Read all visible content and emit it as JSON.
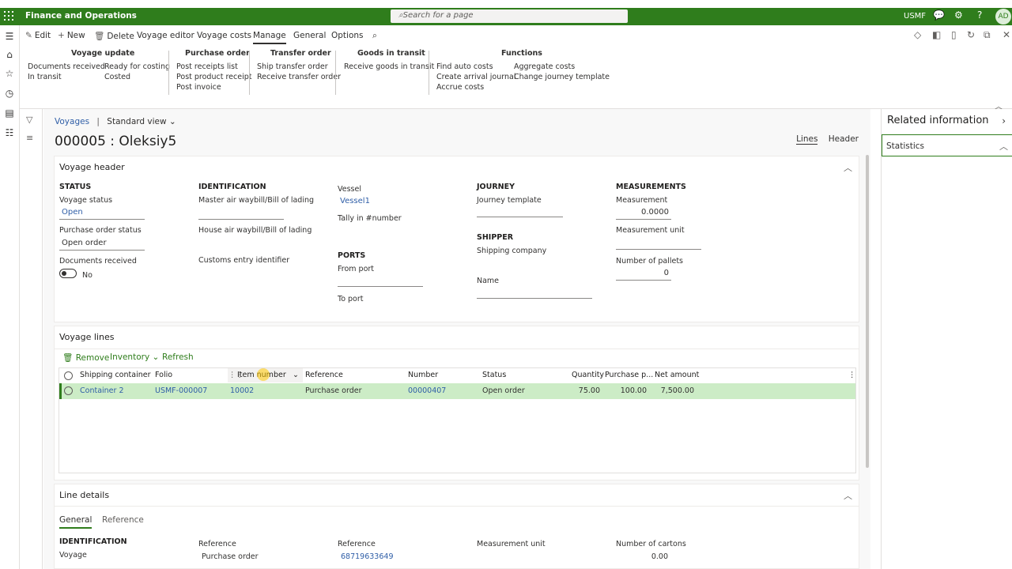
{
  "topbar": {
    "app_title": "Finance and Operations",
    "search_placeholder": "Search for a page",
    "company": "USMF",
    "avatar": "AD"
  },
  "actionbar": {
    "edit": "Edit",
    "new": "New",
    "delete": "Delete",
    "voyage_editor": "Voyage editor",
    "voyage_costs": "Voyage costs",
    "manage": "Manage",
    "general": "General",
    "options": "Options"
  },
  "ribbon": {
    "voyage_update": {
      "title": "Voyage update",
      "items": [
        "Documents received",
        "In transit",
        "Ready for costing",
        "Costed"
      ]
    },
    "purchase_order": {
      "title": "Purchase order",
      "items": [
        "Post receipts list",
        "Post product receipt",
        "Post invoice"
      ]
    },
    "transfer_order": {
      "title": "Transfer order",
      "items": [
        "Ship transfer order",
        "Receive transfer order"
      ]
    },
    "goods_in_transit": {
      "title": "Goods in transit",
      "items": [
        "Receive goods in transit"
      ]
    },
    "functions": {
      "title": "Functions",
      "items": [
        "Find auto costs",
        "Create arrival journal",
        "Accrue costs",
        "Aggregate costs",
        "Change journey template"
      ]
    }
  },
  "page": {
    "breadcrumb_link": "Voyages",
    "separator": "|",
    "view": "Standard view",
    "title": "000005 : Oleksiy5",
    "view_lines": "Lines",
    "view_header": "Header"
  },
  "voyage_header": {
    "title": "Voyage header",
    "status": {
      "section": "STATUS",
      "voyage_status_label": "Voyage status",
      "voyage_status": "Open",
      "po_status_label": "Purchase order status",
      "po_status": "Open order",
      "docs_label": "Documents received",
      "docs_value": "No"
    },
    "identification": {
      "section": "IDENTIFICATION",
      "master_label": "Master air waybill/Bill of lading",
      "house_label": "House air waybill/Bill of lading",
      "customs_label": "Customs entry identifier"
    },
    "vessel": {
      "label": "Vessel",
      "value": "Vessel1",
      "tally_label": "Tally in #number"
    },
    "ports": {
      "section": "PORTS",
      "from_label": "From port",
      "to_label": "To port"
    },
    "journey": {
      "section": "JOURNEY",
      "template_label": "Journey template"
    },
    "shipper": {
      "section": "SHIPPER",
      "company_label": "Shipping company",
      "name_label": "Name"
    },
    "measurements": {
      "section": "MEASUREMENTS",
      "measurement_label": "Measurement",
      "measurement": "0.0000",
      "unit_label": "Measurement unit",
      "pallets_label": "Number of pallets",
      "pallets": "0"
    }
  },
  "voyage_lines": {
    "title": "Voyage lines",
    "remove": "Remove",
    "inventory": "Inventory",
    "refresh": "Refresh",
    "columns": [
      "Shipping container",
      "Folio",
      "Item number",
      "Reference",
      "Number",
      "Status",
      "Quantity",
      "Purchase p...",
      "Net amount"
    ],
    "rows": [
      {
        "container": "Container 2",
        "folio": "USMF-000007",
        "item": "10002",
        "reference": "Purchase order",
        "number": "00000407",
        "status": "Open order",
        "quantity": "75.00",
        "price": "100.00",
        "net": "7,500.00"
      }
    ]
  },
  "line_details": {
    "title": "Line details",
    "tab_general": "General",
    "tab_reference": "Reference",
    "identification": "IDENTIFICATION",
    "voyage_label": "Voyage",
    "reference_label": "Reference",
    "reference_value": "Purchase order",
    "reference2_label": "Reference",
    "reference2_value": "68719633649",
    "unit_label": "Measurement unit",
    "cartons_label": "Number of cartons",
    "cartons_value": "0.00"
  },
  "related": {
    "title": "Related information",
    "statistics": "Statistics"
  },
  "colors": {
    "brand": "#2f7d1c",
    "link": "#2f5ea7",
    "selected_row": "#ccecc6"
  }
}
